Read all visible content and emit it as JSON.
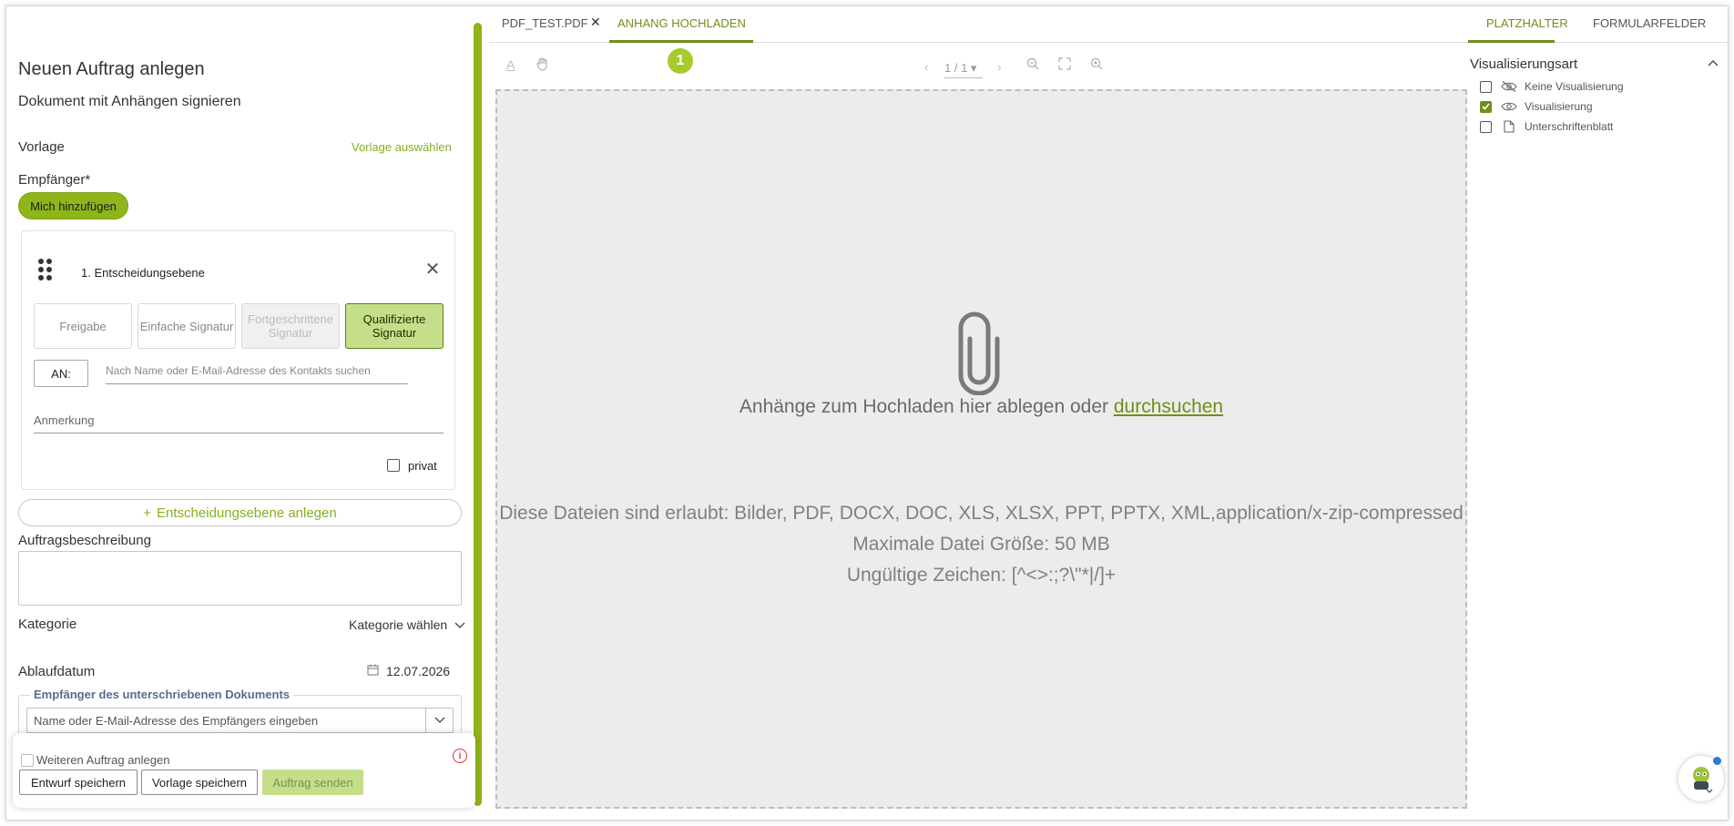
{
  "form": {
    "title": "Neuen Auftrag anlegen",
    "subtitle": "Dokument mit Anhängen signieren",
    "template_label": "Vorlage",
    "template_link": "Vorlage auswählen",
    "recipients_label": "Empfänger*",
    "add_me_button": "Mich hinzufügen",
    "level": {
      "title": "1. Entscheidungsebene",
      "sig_buttons": [
        {
          "label": "Freigabe",
          "state": "normal"
        },
        {
          "label": "Einfache Signatur",
          "state": "normal"
        },
        {
          "label": "Fortgeschrittene Signatur",
          "state": "disabled"
        },
        {
          "label": "Qualifizierte Signatur",
          "state": "active"
        }
      ],
      "an_label": "AN:",
      "contact_placeholder": "Nach Name oder E-Mail-Adresse des Kontakts suchen",
      "remark_placeholder": "Anmerkung",
      "private_label": "privat"
    },
    "add_level_button": "Entscheidungsebene anlegen",
    "description_label": "Auftragsbeschreibung",
    "category_label": "Kategorie",
    "category_value": "Kategorie wählen",
    "expiry_label": "Ablaufdatum",
    "expiry_value": "12.07.2026",
    "signed_recipient_legend": "Empfänger des unterschriebenen Dokuments",
    "signed_recipient_placeholder": "Name oder E-Mail-Adresse des Empfängers eingeben"
  },
  "footer": {
    "another_order_label": "Weiteren Auftrag anlegen",
    "save_draft": "Entwurf speichern",
    "save_template": "Vorlage speichern",
    "send_order": "Auftrag senden"
  },
  "center": {
    "tabs": [
      {
        "label": "PDF_TEST.PDF"
      },
      {
        "label": "ANHANG HOCHLADEN"
      }
    ],
    "step_badge": "1",
    "pager": "1 / 1",
    "drop_text": "Anhänge zum Hochladen hier ablegen oder ",
    "drop_link": "durchsuchen",
    "allowed_files": "Diese Dateien sind erlaubt: Bilder, PDF, DOCX, DOC, XLS, XLSX, PPT, PPTX, XML,application/x-zip-compressed",
    "max_size": "Maximale Datei Größe: 50 MB",
    "invalid_chars": "Ungültige Zeichen: [^<>:;?\\\"*|/]+"
  },
  "right": {
    "tabs": [
      {
        "label": "PLATZHALTER"
      },
      {
        "label": "FORMULARFELDER"
      }
    ],
    "viz_title": "Visualisierungsart",
    "options": [
      {
        "label": "Keine Visualisierung",
        "checked": false
      },
      {
        "label": "Visualisierung",
        "checked": true
      },
      {
        "label": "Unterschriftenblatt",
        "checked": false
      }
    ]
  },
  "colors": {
    "accent": "#8fb51a",
    "accent_dark": "#6f8f1a",
    "active_sig": "#c5de8a"
  }
}
